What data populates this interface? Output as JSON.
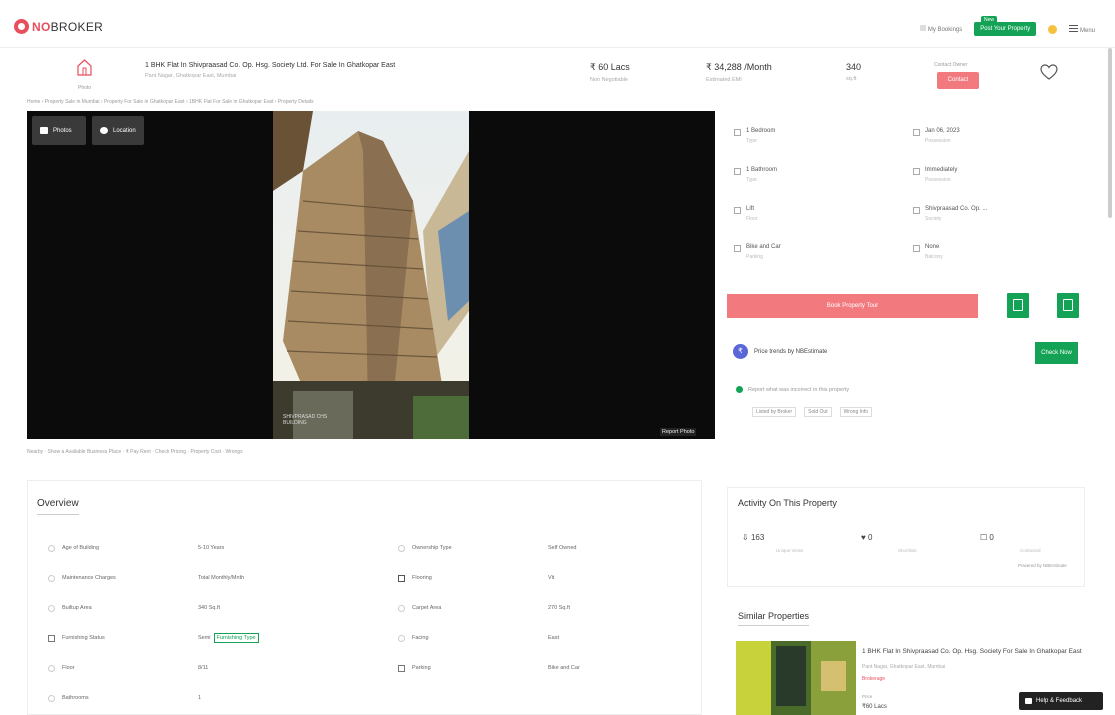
{
  "header": {
    "logo_prefix": "NO",
    "logo_suffix": "BROKER",
    "bookings": "My Bookings",
    "menu": "Menu",
    "post_property": "Post Your Property",
    "new_badge": "New"
  },
  "property": {
    "title": "1 BHK Flat In Shivpraasad Co. Op. Hsg. Society Ltd. For Sale In Ghatkopar East",
    "address": "Pant Nagar, Ghatkopar East, Mumbai",
    "price": "₹ 60 Lacs",
    "price_sub": "Non Negotiable",
    "emi": "₹ 34,288 /Month",
    "emi_sub": "Estimated EMI",
    "area": "340",
    "area_sub": "sq.ft",
    "contact_label": "Contact Owner",
    "contact_btn": "Contact",
    "home_label": "Photo"
  },
  "breadcrumb": "Home  ›  Property Sale in Mumbai  ›  Property For Sale in Ghatkopar East  ›  1BHK Flat For Sale in Ghatkopar East  ›  Property Details",
  "gallery": {
    "photos_btn": "Photos",
    "location_btn": "Location",
    "report": "Report Photo",
    "caption_1": "SHIVPRASAD CHS",
    "caption_2": "BUILDING"
  },
  "details": [
    {
      "label": "1 Bedroom",
      "sub": "Type"
    },
    {
      "label": "Jan 06, 2023",
      "sub": "Possession"
    },
    {
      "label": "1 Bathroom",
      "sub": "Type"
    },
    {
      "label": "Immediately",
      "sub": "Possession"
    },
    {
      "label": "Lift",
      "sub": "Floor"
    },
    {
      "label": "Shivpraasad Co. Op. ...",
      "sub": "Society"
    },
    {
      "label": "Bike and Car",
      "sub": "Parking"
    },
    {
      "label": "None",
      "sub": "Balcony"
    }
  ],
  "actions": {
    "book_visit": "Book Property Tour",
    "sq1": "Calendar",
    "sq2": "Share"
  },
  "price_trend": {
    "icon": "₹",
    "text": "Price trends by NBEstimate",
    "btn": "Check Now"
  },
  "notification": "Report what was incorrect in this property",
  "chips": [
    "Listed by Broker",
    "Sold Out",
    "Wrong Info"
  ],
  "tags_row": "Nearby  ·  Show a Available Business Place  ·  ₹ Pay Rent  ·  Check Pricing  ·  Property Cost  ·  Wrongs",
  "overview": {
    "title": "Overview",
    "rows": [
      {
        "k": "Age of Building",
        "v": "5-10 Years",
        "k2": "Ownership Type",
        "v2": "Self Owned"
      },
      {
        "k": "Maintenance Charges",
        "v": "Total Monthly/Mnth",
        "k2": "Flooring",
        "v2": "Vit"
      },
      {
        "k": "Builtup Area",
        "v": "340 Sq.ft",
        "k2": "Carpet Area",
        "v2": "270 Sq.ft"
      },
      {
        "k": "Furnishing Status",
        "v": "Semi",
        "k2": "Facing",
        "v2": "East"
      },
      {
        "k": "Floor",
        "v": "8/11",
        "k2": "Parking",
        "v2": "Bike and Car"
      },
      {
        "k": "Bathrooms",
        "v": "1",
        "k2": "",
        "v2": ""
      }
    ],
    "furnish_chip": "Furnishing Type"
  },
  "activity": {
    "title": "Activity On This Property",
    "views": "163",
    "views_cap": "Unique Views",
    "likes": "0",
    "likes_cap": "Shortlists",
    "contacts": "0",
    "contacts_cap": "Contacted",
    "footer": "Powered by NBEstimate"
  },
  "similar": {
    "title": "Similar Properties",
    "name": "1 BHK Flat In Shivpraasad Co. Op. Hsg. Society For Sale In Ghatkopar East",
    "sub": "Pant Nagar, Ghatkopar East, Mumbai",
    "tag": "Brokerage",
    "price": "₹60 Lacs",
    "price_cap": "Price"
  },
  "help": "Help & Feedback"
}
